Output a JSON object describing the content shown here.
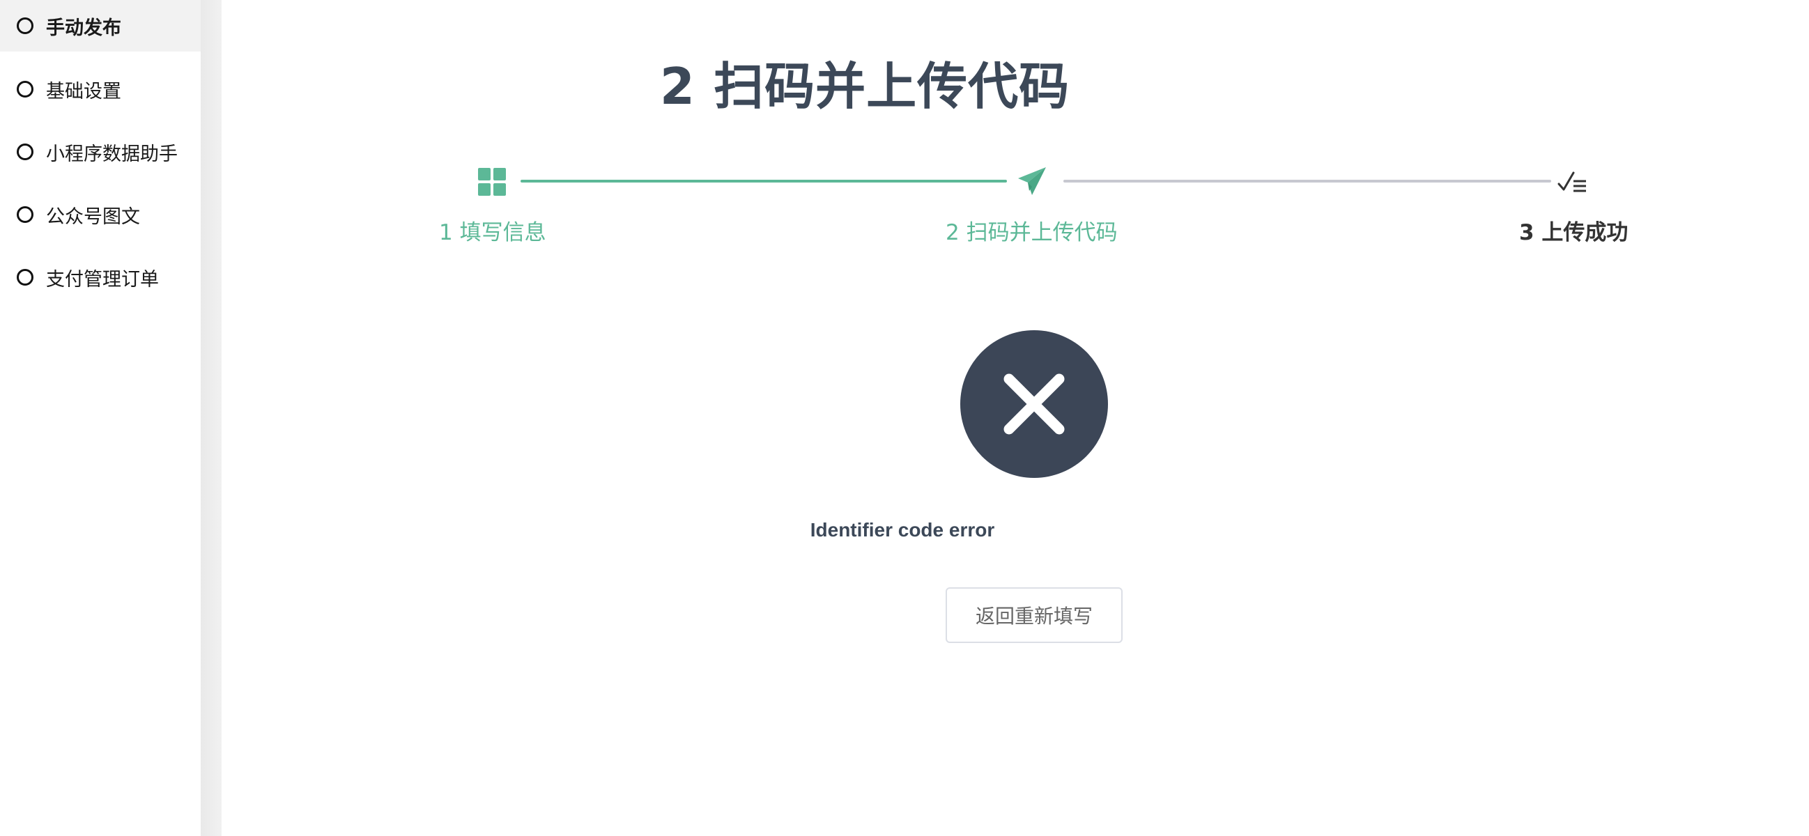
{
  "sidebar": {
    "items": [
      {
        "label": "手动发布",
        "active": true,
        "icon": "circle-outline-icon"
      },
      {
        "label": "基础设置",
        "active": false,
        "icon": "circle-outline-icon"
      },
      {
        "label": "小程序数据助手",
        "active": false,
        "icon": "circle-outline-icon"
      },
      {
        "label": "公众号图文",
        "active": false,
        "icon": "circle-outline-icon"
      },
      {
        "label": "支付管理订单",
        "active": false,
        "icon": "circle-outline-icon"
      }
    ]
  },
  "main": {
    "title": "2 扫码并上传代码",
    "steps": [
      {
        "label": "1 填写信息",
        "icon": "grid-icon",
        "status": "done"
      },
      {
        "label": "2 扫码并上传代码",
        "icon": "paper-plane-icon",
        "status": "current"
      },
      {
        "label": "3 上传成功",
        "icon": "checklist-icon",
        "status": "pending"
      }
    ],
    "result": {
      "icon": "error-x-icon",
      "message": "Identifier code error",
      "back_button_label": "返回重新填写"
    }
  },
  "colors": {
    "accent_green": "#5cb897",
    "dark_slate": "#3c4657",
    "line_gray": "#c7c8d0",
    "sidebar_active_bg": "#f2f2f2"
  }
}
